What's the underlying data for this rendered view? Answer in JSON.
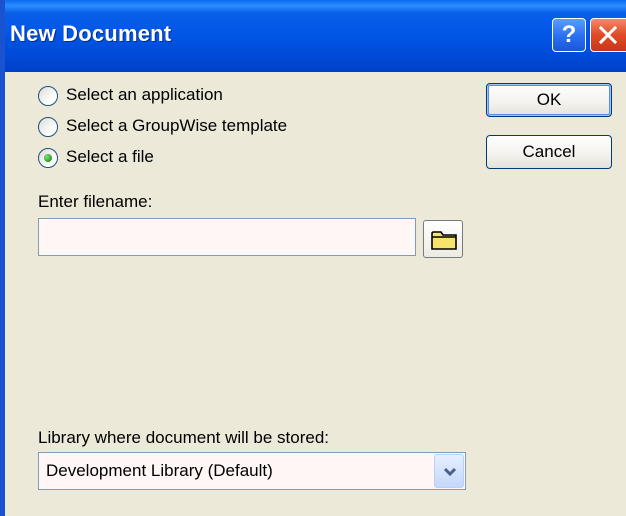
{
  "window": {
    "title": "New Document",
    "help_label": "?"
  },
  "options": [
    {
      "label": "Select an application",
      "selected": false
    },
    {
      "label": "Select a GroupWise template",
      "selected": false
    },
    {
      "label": "Select a file",
      "selected": true
    }
  ],
  "buttons": {
    "ok_label": "OK",
    "cancel_label": "Cancel"
  },
  "filename": {
    "label": "Enter filename:",
    "value": ""
  },
  "library": {
    "label": "Library where document will be stored:",
    "selected": "Development Library  (Default)"
  },
  "icons": {
    "browse": "folder-icon",
    "close": "close-icon",
    "dropdown": "chevron-down-icon"
  },
  "colors": {
    "titlebar": "#0055e5",
    "dialog_bg": "#ece9d8",
    "field_bg": "#fff6f6",
    "radio_selected": "#2ea82e"
  }
}
